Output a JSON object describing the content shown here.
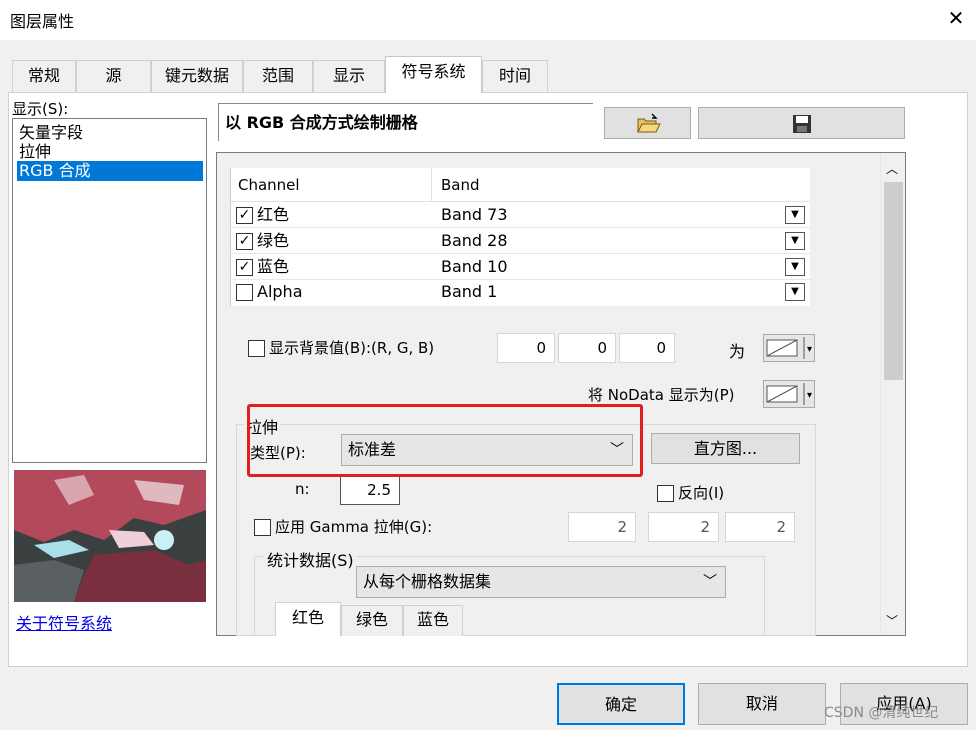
{
  "window": {
    "title": "图层属性",
    "close_glyph": "✕"
  },
  "tabs": [
    {
      "label": "常规"
    },
    {
      "label": "源"
    },
    {
      "label": "键元数据"
    },
    {
      "label": "范围"
    },
    {
      "label": "显示"
    },
    {
      "label": "符号系统",
      "active": true
    },
    {
      "label": "时间"
    }
  ],
  "left": {
    "show_label": "显示(S):",
    "items": [
      {
        "label": "矢量字段"
      },
      {
        "label": "拉伸"
      },
      {
        "label": "RGB 合成",
        "selected": true
      }
    ],
    "about_link": "关于符号系统"
  },
  "heading": "以 RGB 合成方式绘制栅格",
  "band_table": {
    "headers": [
      "Channel",
      "Band"
    ],
    "rows": [
      {
        "channel": "红色",
        "checked": true,
        "band": "Band 73"
      },
      {
        "channel": "绿色",
        "checked": true,
        "band": "Band 28"
      },
      {
        "channel": "蓝色",
        "checked": true,
        "band": "Band 10"
      },
      {
        "channel": "Alpha",
        "checked": false,
        "band": "Band 1"
      }
    ]
  },
  "background": {
    "label": "显示背景值(B):(R, G, B)",
    "values": [
      "0",
      "0",
      "0"
    ],
    "as_label": "为",
    "nodata_label": "将 NoData 显示为(P)"
  },
  "stretch": {
    "group_label": "拉伸",
    "type_label": "类型(P):",
    "type_value": "标准差",
    "histogram_button": "直方图...",
    "n_label": "n:",
    "n_value": "2.5",
    "invert_label": "反向(I)",
    "gamma_label": "应用 Gamma 拉伸(G):",
    "gamma_values": [
      "2",
      "2",
      "2"
    ]
  },
  "stats": {
    "group_label": "统计数据(S)",
    "source_value": "从每个栅格数据集",
    "tabs": [
      "红色",
      "绿色",
      "蓝色"
    ]
  },
  "footer": {
    "ok": "确定",
    "cancel": "取消",
    "apply": "应用(A)"
  },
  "watermark": "CSDN @清纯世纪",
  "colors": {
    "selection": "#0078d7",
    "highlight": "#e02020",
    "link": "#0000ee"
  }
}
